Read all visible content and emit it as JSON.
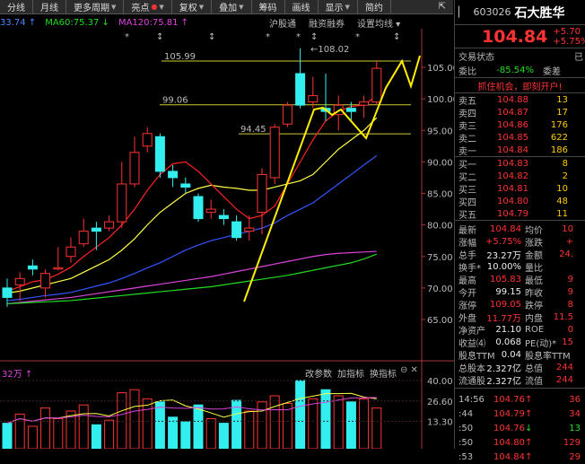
{
  "toolbar": {
    "items": [
      "分线",
      "月线",
      "更多周期",
      "亮点",
      "复权",
      "叠加",
      "筹码",
      "画线",
      "显示",
      "简约"
    ]
  },
  "ma": {
    "ma_partial": "33.74 ↑",
    "ma60": "MA60:75.37 ↓",
    "ma120": "MA120:75.81 ↑",
    "ma60_color": "#22dd22",
    "ma120_color": "#dd44dd"
  },
  "links": [
    "沪股通",
    "融资融券",
    "设置均线"
  ],
  "chart_data": {
    "type": "candlestick",
    "y_ticks": [
      "105.00",
      "100.00",
      "95.00",
      "90.00",
      "85.00",
      "80.00",
      "75.00",
      "70.00",
      "65.00"
    ],
    "annotations": [
      "105.99",
      "99.06",
      "94.45",
      "←108.02"
    ],
    "candles": [
      {
        "o": 70.0,
        "c": 68.5,
        "h": 71.5,
        "l": 67.0
      },
      {
        "o": 70.5,
        "c": 71.5,
        "h": 72.5,
        "l": 68.0
      },
      {
        "o": 73.5,
        "c": 73.0,
        "h": 74.5,
        "l": 72.0
      },
      {
        "o": 70.0,
        "c": 72.3,
        "h": 73.0,
        "l": 68.5
      },
      {
        "o": 73.0,
        "c": 73.2,
        "h": 76.5,
        "l": 72.8
      },
      {
        "o": 75.0,
        "c": 76.5,
        "h": 78.0,
        "l": 74.0
      },
      {
        "o": 77.0,
        "c": 79.0,
        "h": 81.0,
        "l": 76.5
      },
      {
        "o": 79.5,
        "c": 79.0,
        "h": 80.5,
        "l": 76.0
      },
      {
        "o": 79.5,
        "c": 80.5,
        "h": 81.5,
        "l": 79.0
      },
      {
        "o": 80.5,
        "c": 86.5,
        "h": 90.0,
        "l": 79.5
      },
      {
        "o": 86.5,
        "c": 91.5,
        "h": 94.0,
        "l": 86.0
      },
      {
        "o": 92.5,
        "c": 94.5,
        "h": 95.5,
        "l": 91.5
      },
      {
        "o": 94.0,
        "c": 88.5,
        "h": 94.5,
        "l": 87.5
      },
      {
        "o": 88.5,
        "c": 87.5,
        "h": 89.5,
        "l": 86.0
      },
      {
        "o": 86.5,
        "c": 86.0,
        "h": 87.5,
        "l": 85.0
      },
      {
        "o": 84.5,
        "c": 81.0,
        "h": 85.0,
        "l": 80.5
      },
      {
        "o": 82.0,
        "c": 82.5,
        "h": 84.0,
        "l": 81.0
      },
      {
        "o": 81.5,
        "c": 81.0,
        "h": 82.5,
        "l": 80.0
      },
      {
        "o": 80.5,
        "c": 78.0,
        "h": 81.5,
        "l": 77.5
      },
      {
        "o": 79.0,
        "c": 79.5,
        "h": 81.5,
        "l": 77.5
      },
      {
        "o": 82.0,
        "c": 88.0,
        "h": 89.0,
        "l": 78.5
      },
      {
        "o": 87.5,
        "c": 95.5,
        "h": 96.0,
        "l": 86.5
      },
      {
        "o": 96.0,
        "c": 99.0,
        "h": 99.5,
        "l": 95.5
      },
      {
        "o": 104.0,
        "c": 99.0,
        "h": 108.02,
        "l": 98.5
      },
      {
        "o": 99.5,
        "c": 100.5,
        "h": 103.5,
        "l": 98.5
      },
      {
        "o": 98.5,
        "c": 98.0,
        "h": 104.0,
        "l": 96.5
      },
      {
        "o": 97.5,
        "c": 99.0,
        "h": 100.5,
        "l": 95.0
      },
      {
        "o": 98.5,
        "c": 98.0,
        "h": 99.5,
        "l": 96.5
      },
      {
        "o": 99.0,
        "c": 99.5,
        "h": 100.5,
        "l": 97.0
      },
      {
        "o": 99.5,
        "c": 104.84,
        "h": 105.99,
        "l": 99.06
      }
    ],
    "ma5": [
      69.5,
      70.2,
      71.0,
      71.3,
      72.2,
      73.3,
      75.0,
      76.5,
      78.0,
      80.0,
      82.5,
      85.5,
      88.0,
      89.7,
      90.0,
      88.5,
      86.5,
      84.5,
      82.5,
      81.0,
      81.5,
      83.0,
      86.5,
      90.0,
      93.5,
      96.5,
      98.0,
      98.8,
      99.0,
      100.5
    ],
    "ma10": [
      69.2,
      69.5,
      70.0,
      70.5,
      71.0,
      71.5,
      72.5,
      73.5,
      74.5,
      76.0,
      77.8,
      80.0,
      82.0,
      83.5,
      85.0,
      85.8,
      86.3,
      86.0,
      85.8,
      85.5,
      85.5,
      86.0,
      86.5,
      87.0,
      88.0,
      90.0,
      92.0,
      93.5,
      95.0,
      97.0
    ],
    "ma20": [
      68.0,
      68.2,
      68.5,
      68.8,
      69.0,
      69.3,
      69.8,
      70.3,
      70.8,
      71.5,
      72.3,
      73.2,
      74.0,
      75.0,
      76.0,
      76.8,
      77.5,
      78.0,
      78.5,
      79.0,
      79.5,
      80.3,
      81.5,
      82.5,
      83.5,
      85.0,
      86.5,
      88.0,
      89.5,
      91.0
    ],
    "ma60": [
      67.5,
      67.6,
      67.7,
      67.8,
      67.9,
      68.0,
      68.2,
      68.4,
      68.6,
      68.8,
      69.0,
      69.2,
      69.4,
      69.6,
      69.8,
      70.0,
      70.2,
      70.5,
      70.8,
      71.1,
      71.4,
      71.7,
      72.0,
      72.4,
      72.8,
      73.2,
      73.6,
      74.0,
      74.6,
      75.37
    ],
    "ma120": [
      67.5,
      67.7,
      67.9,
      68.1,
      68.3,
      68.5,
      68.8,
      69.1,
      69.4,
      69.7,
      70.0,
      70.3,
      70.6,
      70.9,
      71.2,
      71.5,
      71.8,
      72.2,
      72.6,
      73.0,
      73.4,
      73.8,
      74.2,
      74.6,
      75.0,
      75.3,
      75.5,
      75.6,
      75.7,
      75.81
    ],
    "trend": [
      [
        272,
        336
      ],
      [
        350,
        122
      ],
      [
        360,
        120
      ],
      [
        370,
        128
      ],
      [
        380,
        122
      ],
      [
        408,
        154
      ],
      [
        430,
        98
      ],
      [
        448,
        68
      ],
      [
        458,
        96
      ],
      [
        468,
        62
      ]
    ],
    "volume_ticks": [
      "40.00",
      "26.60",
      "13.30"
    ],
    "volume_label": "32万 ↑",
    "volume_links": [
      "改参数",
      "加指标",
      "换指标"
    ],
    "volume": [
      {
        "v": 12,
        "up": false
      },
      {
        "v": 18,
        "up": true
      },
      {
        "v": 10,
        "up": true
      },
      {
        "v": 22,
        "up": true
      },
      {
        "v": 15,
        "up": true
      },
      {
        "v": 20,
        "up": true
      },
      {
        "v": 24,
        "up": true
      },
      {
        "v": 11,
        "up": false
      },
      {
        "v": 14,
        "up": true
      },
      {
        "v": 32,
        "up": true
      },
      {
        "v": 34,
        "up": true
      },
      {
        "v": 28,
        "up": true
      },
      {
        "v": 26,
        "up": false
      },
      {
        "v": 16,
        "up": false
      },
      {
        "v": 13,
        "up": false
      },
      {
        "v": 24,
        "up": false
      },
      {
        "v": 15,
        "up": true
      },
      {
        "v": 12,
        "up": false
      },
      {
        "v": 27,
        "up": false
      },
      {
        "v": 20,
        "up": true
      },
      {
        "v": 26,
        "up": true
      },
      {
        "v": 30,
        "up": true
      },
      {
        "v": 25,
        "up": true
      },
      {
        "v": 40,
        "up": false
      },
      {
        "v": 28,
        "up": true
      },
      {
        "v": 34,
        "up": false
      },
      {
        "v": 30,
        "up": true
      },
      {
        "v": 26,
        "up": false
      },
      {
        "v": 28,
        "up": true
      },
      {
        "v": 22,
        "up": true
      }
    ]
  },
  "panel": {
    "code": "603026",
    "name": "石大胜华",
    "price": "104.84",
    "change": "+5.70",
    "change_pct": "+5.75%",
    "status_label": "交易状态",
    "wb_label": "委比",
    "wb_value": "-85.54%",
    "wc_label": "委差",
    "ad": "抓住机会，即刻开户!",
    "asks": [
      {
        "label": "卖五",
        "price": "104.88",
        "vol": "13"
      },
      {
        "label": "卖四",
        "price": "104.87",
        "vol": "17"
      },
      {
        "label": "卖三",
        "price": "104.86",
        "vol": "176"
      },
      {
        "label": "卖二",
        "price": "104.85",
        "vol": "622"
      },
      {
        "label": "卖一",
        "price": "104.84",
        "vol": "186"
      }
    ],
    "bids": [
      {
        "label": "买一",
        "price": "104.83",
        "vol": "8"
      },
      {
        "label": "买二",
        "price": "104.82",
        "vol": "2"
      },
      {
        "label": "买三",
        "price": "104.81",
        "vol": "10"
      },
      {
        "label": "买四",
        "price": "104.80",
        "vol": "48"
      },
      {
        "label": "买五",
        "price": "104.79",
        "vol": "11"
      }
    ],
    "stats": [
      {
        "l1": "最新",
        "v1": "104.84",
        "c1": "red",
        "l2": "均价",
        "v2": "10"
      },
      {
        "l1": "涨幅",
        "v1": "+5.75%",
        "c1": "red",
        "l2": "涨跌",
        "v2": "+"
      },
      {
        "l1": "总手",
        "v1": "23.27万",
        "c1": "white",
        "l2": "金额",
        "v2": "24."
      },
      {
        "l1": "换手*",
        "v1": "10.00%",
        "c1": "white",
        "l2": "量比",
        "v2": ""
      },
      {
        "l1": "最高",
        "v1": "105.83",
        "c1": "red",
        "l2": "最低",
        "v2": "9"
      },
      {
        "l1": "今开",
        "v1": "99.15",
        "c1": "white",
        "l2": "昨收",
        "v2": "9"
      },
      {
        "l1": "涨停",
        "v1": "109.05",
        "c1": "red",
        "l2": "跌停",
        "v2": "8"
      },
      {
        "l1": "外盘",
        "v1": "11.77万",
        "c1": "red",
        "l2": "内盘",
        "v2": "11.5"
      },
      {
        "l1": "净资产",
        "v1": "21.10",
        "c1": "white",
        "l2": "ROE",
        "v2": "0"
      },
      {
        "l1": "收益⑷",
        "v1": "0.068",
        "c1": "white",
        "l2": "PE(动)*",
        "v2": "15"
      },
      {
        "l1": "股息TTM",
        "v1": "0.04",
        "c1": "white",
        "l2": "股息率TTM",
        "v2": ""
      },
      {
        "l1": "总股本",
        "v1": "2.327亿",
        "c1": "white",
        "l2": "总值",
        "v2": "244"
      },
      {
        "l1": "流通股",
        "v1": "2.327亿",
        "c1": "white",
        "l2": "流值",
        "v2": "244"
      }
    ],
    "ticks": [
      {
        "t": "14:56",
        "p": "104.76",
        "arrow": "↑",
        "ac": "red",
        "v": "36",
        "vc": "red"
      },
      {
        "t": ":44",
        "p": "104.79",
        "arrow": "↑",
        "ac": "red",
        "v": "34",
        "vc": "red"
      },
      {
        "t": ":50",
        "p": "104.76",
        "arrow": "↓",
        "ac": "green",
        "v": "13",
        "vc": "green"
      },
      {
        "t": ":50",
        "p": "104.80",
        "arrow": "↑",
        "ac": "red",
        "v": "129",
        "vc": "red"
      },
      {
        "t": ":53",
        "p": "104.84",
        "arrow": "↑",
        "ac": "red",
        "v": "29",
        "vc": "red"
      }
    ]
  }
}
